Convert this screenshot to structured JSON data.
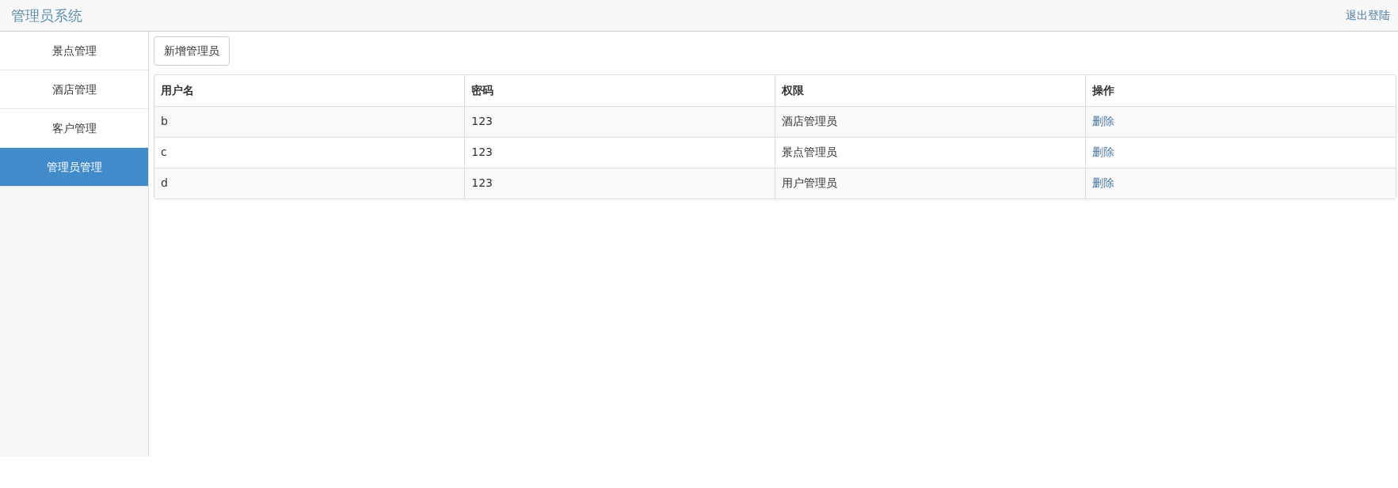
{
  "header": {
    "brand": "管理员系统",
    "logout": "退出登陆"
  },
  "sidebar": {
    "items": [
      {
        "label": "景点管理",
        "selected": false
      },
      {
        "label": "酒店管理",
        "selected": false
      },
      {
        "label": "客户管理",
        "selected": false
      },
      {
        "label": "管理员管理",
        "selected": true
      }
    ]
  },
  "add_button": "新增管理员",
  "table": {
    "columns": [
      "用户名",
      "密码",
      "权限",
      "操作"
    ],
    "rows": [
      {
        "username": "b",
        "password": "123",
        "role": "酒店管理员",
        "action": "删除"
      },
      {
        "username": "c",
        "password": "123",
        "role": "景点管理员",
        "action": "删除"
      },
      {
        "username": "d",
        "password": "123",
        "role": "用户管理员",
        "action": "删除"
      }
    ]
  }
}
